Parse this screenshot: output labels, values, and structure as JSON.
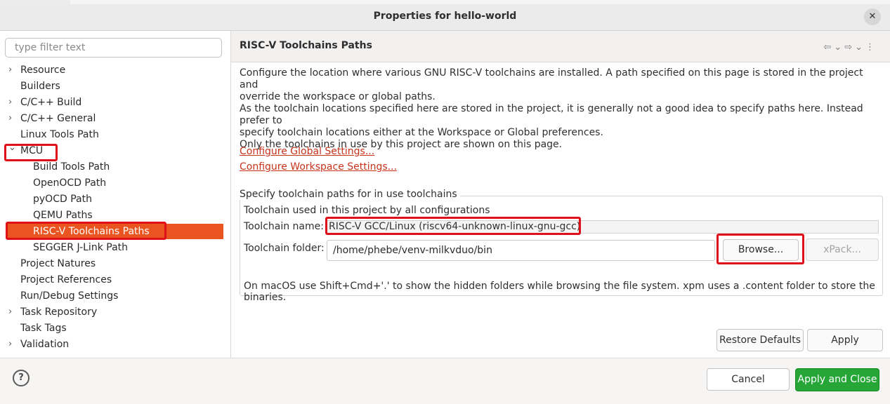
{
  "window": {
    "title": "Properties for hello-world",
    "close_icon": "close-icon"
  },
  "filter": {
    "placeholder": "type filter text"
  },
  "tree": [
    {
      "label": "Resource",
      "expander": "collapsed"
    },
    {
      "label": "Builders",
      "expander": "none"
    },
    {
      "label": "C/C++ Build",
      "expander": "collapsed"
    },
    {
      "label": "C/C++ General",
      "expander": "collapsed"
    },
    {
      "label": "Linux Tools Path",
      "expander": "none"
    },
    {
      "label": "MCU",
      "expander": "expanded"
    },
    {
      "label": "Build Tools Path",
      "expander": "none"
    },
    {
      "label": "OpenOCD Path",
      "expander": "none"
    },
    {
      "label": "pyOCD Path",
      "expander": "none"
    },
    {
      "label": "QEMU Paths",
      "expander": "none"
    },
    {
      "label": "RISC-V Toolchains Paths",
      "expander": "none",
      "selected": true
    },
    {
      "label": "SEGGER J-Link Path",
      "expander": "none"
    },
    {
      "label": "Project Natures",
      "expander": "none"
    },
    {
      "label": "Project References",
      "expander": "none"
    },
    {
      "label": "Run/Debug Settings",
      "expander": "none"
    },
    {
      "label": "Task Repository",
      "expander": "collapsed"
    },
    {
      "label": "Task Tags",
      "expander": "none"
    },
    {
      "label": "Validation",
      "expander": "collapsed"
    }
  ],
  "page": {
    "title": "RISC-V Toolchains Paths",
    "nav_icons": [
      "back-arrow-icon",
      "chevron-down-icon",
      "forward-arrow-icon",
      "chevron-down-icon",
      "more-vertical-icon"
    ],
    "description": [
      "Configure the location where various GNU RISC-V toolchains are installed. A path specified on this page is stored in the project and",
      "override the workspace or global paths.",
      "As the toolchain locations specified here are stored in the project, it is generally not a good idea to specify paths here. Instead prefer to",
      "specify toolchain locations either at the Workspace or Global preferences.",
      "Only the toolchains in use by this project are shown on this page."
    ],
    "link_global": "Configure Global Settings...",
    "link_workspace": "Configure Workspace Settings...",
    "group_title": "Specify toolchain paths for in use toolchains",
    "group_subtitle": "Toolchain used in this project by all configurations",
    "toolchain_name_label": "Toolchain name:",
    "toolchain_name_value": "RISC-V GCC/Linux (riscv64-unknown-linux-gnu-gcc)",
    "toolchain_folder_label": "Toolchain folder:",
    "toolchain_folder_value": "/home/phebe/venv-milkvduo/bin",
    "browse_label": "Browse...",
    "xpack_label": "xPack...",
    "hint": "On macOS use Shift+Cmd+'.' to show the hidden folders while browsing the file system. xpm uses a .content folder to store the binaries.",
    "restore_defaults_label": "Restore Defaults",
    "apply_label": "Apply"
  },
  "footer": {
    "help_icon": "help-icon",
    "cancel_label": "Cancel",
    "apply_close_label": "Apply and Close"
  },
  "colors": {
    "selection": "#e95420",
    "highlight_box": "#e0101b",
    "link": "#c7331b",
    "primary_button": "#26a637"
  }
}
